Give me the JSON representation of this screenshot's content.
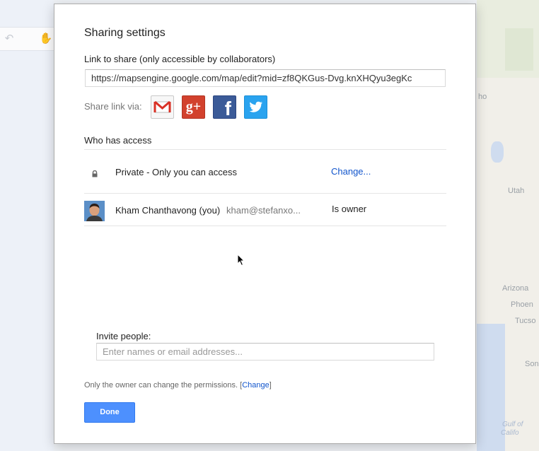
{
  "background": {
    "map_labels": [
      "ho",
      "Utah",
      "Arizona",
      "Phoen",
      "Tucso",
      "Son",
      "Gulf of",
      "Califo"
    ]
  },
  "dialog": {
    "title": "Sharing settings",
    "link_section": {
      "label": "Link to share (only accessible by collaborators)",
      "url": "https://mapsengine.google.com/map/edit?mid=zf8QKGus-Dvg.knXHQyu3egKc"
    },
    "share_via": {
      "label": "Share link via:",
      "services": [
        {
          "name": "gmail-icon",
          "glyph": "M"
        },
        {
          "name": "google-plus-icon",
          "glyph": "g+"
        },
        {
          "name": "facebook-icon",
          "glyph": "f"
        },
        {
          "name": "twitter-icon",
          "glyph": "bird"
        }
      ]
    },
    "access": {
      "heading": "Who has access",
      "visibility_text": "Private - Only you can access",
      "change_link": "Change...",
      "users": [
        {
          "name": "Kham Chanthavong (you)",
          "email": "kham@stefanxo...",
          "role": "Is owner"
        }
      ]
    },
    "invite": {
      "label": "Invite people:",
      "placeholder": "Enter names or email addresses...",
      "value": ""
    },
    "permissions_note": {
      "text": "Only the owner can change the permissions.",
      "link_open": "[",
      "link_label": "Change",
      "link_close": "]"
    },
    "done_label": "Done"
  },
  "colors": {
    "accent_blue": "#4d90fe",
    "link_blue": "#1155cc",
    "gplus_red": "#d2412d",
    "facebook_blue": "#3b5b98",
    "twitter_blue": "#2aa3ef"
  }
}
